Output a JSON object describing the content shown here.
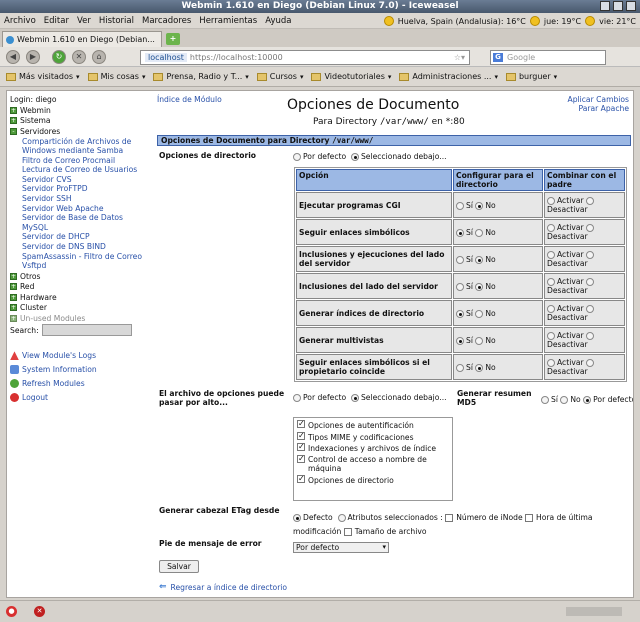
{
  "window": {
    "title": "Webmin 1.610 en Diego (Debian Linux 7.0) - Iceweasel"
  },
  "menubar": {
    "items": [
      "Archivo",
      "Editar",
      "Ver",
      "Historial",
      "Marcadores",
      "Herramientas",
      "Ayuda"
    ],
    "tray": {
      "weather1": "Huelva, Spain (Andalusia): 16°C",
      "weather2": "jue: 19°C",
      "weather3": "vie: 21°C"
    }
  },
  "tab": {
    "label": "Webmin 1.610 en Diego (Debian..."
  },
  "navbar": {
    "host": "localhost",
    "url": "https://localhost:10000",
    "search_placeholder": "Google"
  },
  "bookmarks": [
    "Más visitados",
    "Mis cosas",
    "Prensa, Radio y T...",
    "Cursos",
    "Videotutoriales",
    "Administraciones ...",
    "burguer"
  ],
  "sidebar": {
    "login": "Login: diego",
    "top_cats": [
      "Webmin",
      "Sistema",
      "Servidores"
    ],
    "servers": [
      "Compartición de Archivos de Windows mediante Samba",
      "Filtro de Correo Procmail",
      "Lectura de Correo de Usuarios",
      "Servidor CVS",
      "Servidor ProFTPD",
      "Servidor SSH",
      "Servidor Web Apache",
      "Servidor de Base de Datos MySQL",
      "Servidor de DHCP",
      "Servidor de DNS BIND",
      "SpamAssassin - Filtro de Correo",
      "Vsftpd"
    ],
    "bottom_cats": [
      "Otros",
      "Red",
      "Hardware",
      "Cluster"
    ],
    "unused": "Un-used Modules",
    "search_label": "Search:",
    "links": [
      "View Module's Logs",
      "System Information",
      "Refresh Modules",
      "Logout"
    ]
  },
  "page": {
    "index_link": "Índice de Módulo",
    "apply_link": "Aplicar Cambios",
    "stop_link": "Parar Apache",
    "title": "Opciones de Documento",
    "subtitle_prefix": "Para Directory",
    "subtitle_path": "/var/www/",
    "subtitle_suffix": "en *:80",
    "header_prefix": "Opciones de Documento para Directory",
    "header_path": "/var/www/"
  },
  "dir_options": {
    "label": "Opciones de directorio",
    "radio_default": "Por defecto",
    "radio_selected": "Seleccionado debajo...",
    "col_option": "Opción",
    "col_config": "Configurar para el directorio",
    "col_combine": "Combinar con el padre",
    "yes": "Sí",
    "no": "No",
    "activate": "Activar",
    "deactivate": "Desactivar",
    "rows": [
      {
        "name": "Ejecutar programas CGI",
        "config": "no"
      },
      {
        "name": "Seguir enlaces simbólicos",
        "config": "yes"
      },
      {
        "name": "Inclusiones y ejecuciones del lado del servidor",
        "config": "no"
      },
      {
        "name": "Inclusiones del lado del servidor",
        "config": "no"
      },
      {
        "name": "Generar índices de directorio",
        "config": "yes"
      },
      {
        "name": "Generar multivistas",
        "config": "yes"
      },
      {
        "name": "Seguir enlaces simbólicos si el propietario coincide",
        "config": "no"
      }
    ]
  },
  "override": {
    "label": "El archivo de opciones puede pasar por alto...",
    "radio_default": "Por defecto",
    "radio_selected": "Seleccionado debajo...",
    "items": [
      "Opciones de autentificación",
      "Tipos MIME y codificaciones",
      "Indexaciones y archivos de índice",
      "Control de acceso a nombre de máquina",
      "Opciones de directorio"
    ]
  },
  "md5": {
    "label": "Generar resumen MD5",
    "yes": "Sí",
    "no": "No",
    "default": "Por defecto"
  },
  "etag": {
    "label": "Generar cabezal ETag desde",
    "options": [
      "Defecto",
      "Atributos seleccionados :",
      "Número de iNode",
      "Hora de última modificación",
      "Tamaño de archivo"
    ]
  },
  "footer_msg": {
    "label": "Pie de mensaje de error",
    "value": "Por defecto"
  },
  "save_button": "Salvar",
  "back_link": "Regresar a índice de directorio"
}
